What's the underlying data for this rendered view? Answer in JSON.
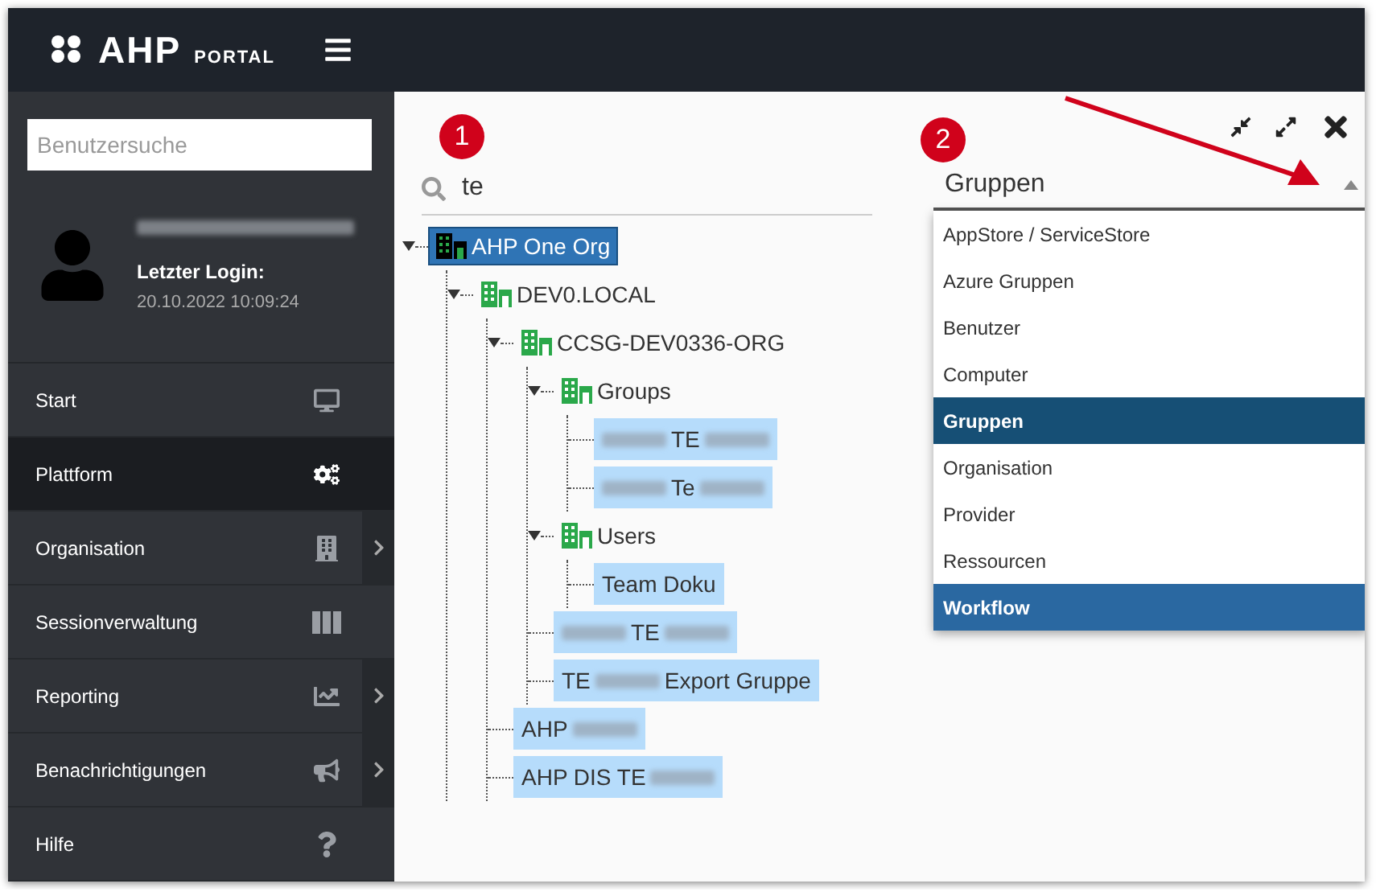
{
  "header": {
    "logo": "AHP",
    "logo_sub": "PORTAL"
  },
  "sidebar": {
    "search": {
      "placeholder": "Benutzersuche"
    },
    "user": {
      "name_redacted": true,
      "login_label": "Letzter Login:",
      "login_time": "20.10.2022 10:09:24"
    },
    "items": [
      {
        "label": "Start",
        "selected": false,
        "submenu": false
      },
      {
        "label": "Plattform",
        "selected": true,
        "submenu": false
      },
      {
        "label": "Organisation",
        "selected": false,
        "submenu": true
      },
      {
        "label": "Sessionverwaltung",
        "selected": false,
        "submenu": false
      },
      {
        "label": "Reporting",
        "selected": false,
        "submenu": true
      },
      {
        "label": "Benachrichtigungen",
        "selected": false,
        "submenu": true
      },
      {
        "label": "Hilfe",
        "selected": false,
        "submenu": false
      }
    ]
  },
  "search": {
    "value": "te"
  },
  "tree": [
    {
      "kind": "org",
      "parts": [
        {
          "text": "AHP One Org"
        }
      ],
      "selected": true,
      "expanded": true,
      "children": [
        {
          "kind": "org",
          "parts": [
            {
              "text": "DEV0.LOCAL"
            }
          ],
          "selected": false,
          "expanded": true,
          "children": [
            {
              "kind": "org",
              "parts": [
                {
                  "text": "CCSG-DEV0336-ORG"
                }
              ],
              "selected": false,
              "expanded": true,
              "children": [
                {
                  "kind": "org",
                  "parts": [
                    {
                      "text": "Groups"
                    }
                  ],
                  "selected": false,
                  "expanded": true,
                  "children": [
                    {
                      "kind": "entry",
                      "parts": [
                        {
                          "redacted": true
                        },
                        {
                          "text": "TE"
                        },
                        {
                          "redacted": true
                        }
                      ],
                      "selected": false
                    },
                    {
                      "kind": "entry",
                      "parts": [
                        {
                          "redacted": true
                        },
                        {
                          "text": "Te"
                        },
                        {
                          "redacted": true
                        }
                      ],
                      "selected": false
                    }
                  ]
                },
                {
                  "kind": "org",
                  "parts": [
                    {
                      "text": "Users"
                    }
                  ],
                  "selected": false,
                  "expanded": true,
                  "children": [
                    {
                      "kind": "entry",
                      "parts": [
                        {
                          "text": "Team Doku"
                        }
                      ],
                      "selected": false
                    }
                  ]
                },
                {
                  "kind": "entry",
                  "parts": [
                    {
                      "redacted": true
                    },
                    {
                      "text": "TE"
                    },
                    {
                      "redacted": true
                    }
                  ],
                  "selected": false
                },
                {
                  "kind": "entry",
                  "parts": [
                    {
                      "text": "TE"
                    },
                    {
                      "redacted": true
                    },
                    {
                      "text": "Export Gruppe"
                    }
                  ],
                  "selected": false
                }
              ]
            },
            {
              "kind": "entry",
              "parts": [
                {
                  "text": "AHP"
                },
                {
                  "redacted": true
                }
              ],
              "selected": false
            },
            {
              "kind": "entry",
              "parts": [
                {
                  "text": "AHP DIS TE"
                },
                {
                  "redacted": true
                }
              ],
              "selected": false
            }
          ]
        }
      ]
    }
  ],
  "select": {
    "value": "Gruppen",
    "options": [
      {
        "label": "AppStore / ServiceStore",
        "selected": false,
        "hovered": false
      },
      {
        "label": "Azure Gruppen",
        "selected": false,
        "hovered": false
      },
      {
        "label": "Benutzer",
        "selected": false,
        "hovered": false
      },
      {
        "label": "Computer",
        "selected": false,
        "hovered": false
      },
      {
        "label": "Gruppen",
        "selected": true,
        "hovered": false
      },
      {
        "label": "Organisation",
        "selected": false,
        "hovered": false
      },
      {
        "label": "Provider",
        "selected": false,
        "hovered": false
      },
      {
        "label": "Ressourcen",
        "selected": false,
        "hovered": false
      },
      {
        "label": "Workflow",
        "selected": false,
        "hovered": true
      }
    ]
  },
  "callouts": [
    "1",
    "2"
  ]
}
